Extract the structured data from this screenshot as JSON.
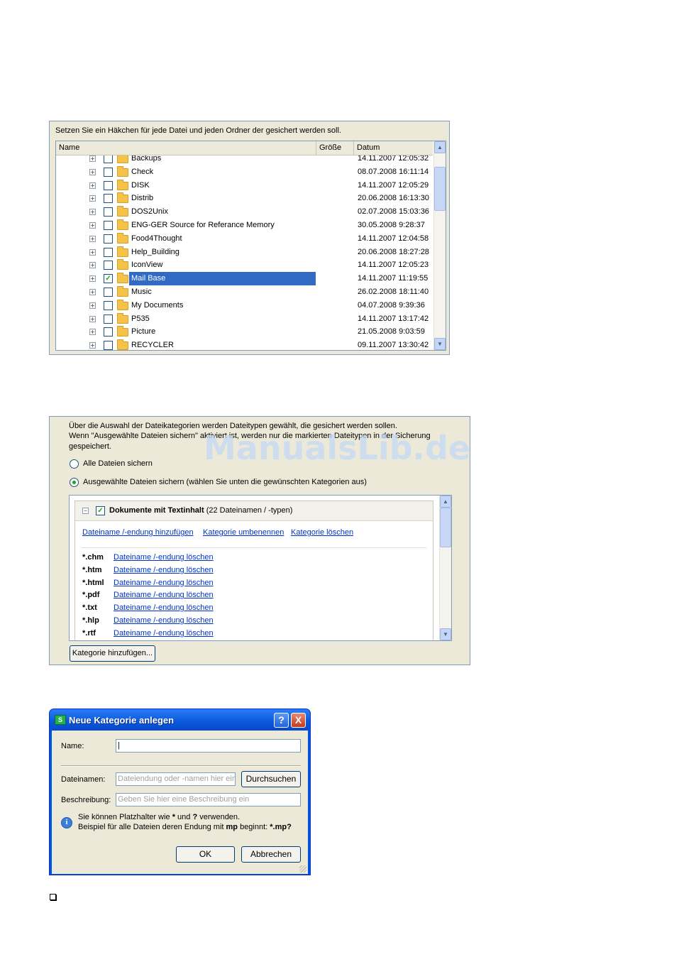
{
  "file_panel": {
    "instruction": "Setzen Sie ein Häkchen für jede Datei und jeden Ordner der gesichert werden soll.",
    "columns": [
      "Name",
      "Größe",
      "Datum"
    ],
    "rows": [
      {
        "name": "Backups",
        "date": "14.11.2007 12:05:32",
        "checked": false,
        "selected": false
      },
      {
        "name": "Check",
        "date": "08.07.2008 16:11:14",
        "checked": false,
        "selected": false
      },
      {
        "name": "DISK",
        "date": "14.11.2007 12:05:29",
        "checked": false,
        "selected": false
      },
      {
        "name": "Distrib",
        "date": "20.06.2008 16:13:30",
        "checked": false,
        "selected": false
      },
      {
        "name": "DOS2Unix",
        "date": "02.07.2008 15:03:36",
        "checked": false,
        "selected": false
      },
      {
        "name": "ENG-GER Source for Referance Memory",
        "date": "30.05.2008 9:28:37",
        "checked": false,
        "selected": false
      },
      {
        "name": "Food4Thought",
        "date": "14.11.2007 12:04:58",
        "checked": false,
        "selected": false
      },
      {
        "name": "Help_Building",
        "date": "20.06.2008 18:27:28",
        "checked": false,
        "selected": false
      },
      {
        "name": "IconView",
        "date": "14.11.2007 12:05:23",
        "checked": false,
        "selected": false
      },
      {
        "name": "Mail Base",
        "date": "14.11.2007 11:19:55",
        "checked": true,
        "selected": true
      },
      {
        "name": "Music",
        "date": "26.02.2008 18:11:40",
        "checked": false,
        "selected": false
      },
      {
        "name": "My Documents",
        "date": "04.07.2008 9:39:36",
        "checked": false,
        "selected": false
      },
      {
        "name": "P535",
        "date": "14.11.2007 13:17:42",
        "checked": false,
        "selected": false
      },
      {
        "name": "Picture",
        "date": "21.05.2008 9:03:59",
        "checked": false,
        "selected": false
      },
      {
        "name": "RECYCLER",
        "date": "09.11.2007 13:30:42",
        "checked": false,
        "selected": false
      }
    ]
  },
  "category_panel": {
    "desc_line1": "Über die Auswahl der Dateikategorien werden Dateitypen gewählt, die gesichert werden sollen.",
    "desc_line2": "Wenn \"Ausgewählte Dateien sichern\" aktiviert ist, werden nur die markierten Dateitypen in der Sicherung",
    "desc_line3": "gespeichert.",
    "radio_all": "Alle Dateien sichern",
    "radio_selected": "Ausgewählte Dateien sichern (wählen Sie unten die gewünschten Kategorien aus)",
    "group_title": "Dokumente mit Textinhalt",
    "group_subtitle": "(22 Dateinamen / -typen)",
    "link_add": "Dateiname /-endung hinzufügen",
    "link_rename": "Kategorie umbenennen",
    "link_delete": "Kategorie löschen",
    "delete_link_label": "Dateiname /-endung löschen",
    "extensions": [
      "*.chm",
      "*.htm",
      "*.html",
      "*.pdf",
      "*.txt",
      "*.hlp",
      "*.rtf"
    ],
    "add_category_button": "Kategorie hinzufügen..."
  },
  "dialog": {
    "title": "Neue Kategorie anlegen",
    "help_button": "?",
    "close_button": "X",
    "name_label": "Name:",
    "filenames_label": "Dateinamen:",
    "filenames_placeholder": "Dateiendung oder -namen hier ein",
    "browse_button": "Durchsuchen",
    "description_label": "Beschreibung:",
    "description_placeholder": "Geben Sie hier eine Beschreibung ein",
    "hint_line1_a": "Sie können Platzhalter wie ",
    "hint_line1_star": "*",
    "hint_line1_b": " und ",
    "hint_line1_q": "?",
    "hint_line1_c": " verwenden.",
    "hint_line2_a": "Beispiel für alle Dateien deren Endung mit ",
    "hint_line2_mp": "mp",
    "hint_line2_b": " beginnt: ",
    "hint_line2_example": "*.mp?",
    "ok_button": "OK",
    "cancel_button": "Abbrechen"
  },
  "watermark": "ManualsLib.de"
}
